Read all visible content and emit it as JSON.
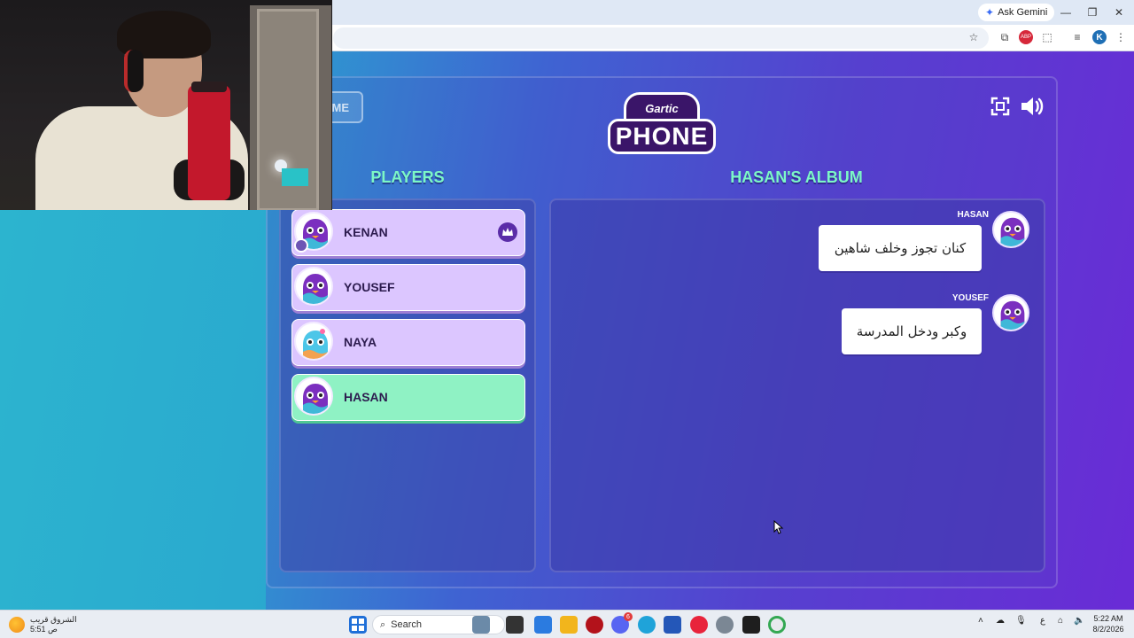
{
  "browser": {
    "gemini_label": "Ask Gemini",
    "ext_badge": "ABP",
    "profile_initial": "K"
  },
  "game": {
    "home_label": "ME",
    "logo_top": "Gartic",
    "logo_main": "PHONE",
    "players_title": "PLAYERS",
    "album_title": "HASAN'S ALBUM"
  },
  "players": [
    {
      "name": "KENAN",
      "host": true,
      "active": false
    },
    {
      "name": "YOUSEF",
      "host": false,
      "active": false
    },
    {
      "name": "NAYA",
      "host": false,
      "active": false
    },
    {
      "name": "HASAN",
      "host": false,
      "active": true
    }
  ],
  "album": {
    "messages": [
      {
        "author": "HASAN",
        "text": "كنان تجوز وخلف شاهين"
      },
      {
        "author": "YOUSEF",
        "text": "وكبر ودخل المدرسة"
      }
    ]
  },
  "taskbar": {
    "weather_title": "الشروق قريب",
    "weather_time": "5:51 ص",
    "search_label": "Search",
    "lang": "ع",
    "time": "5:22 AM",
    "date": "8/2/2026",
    "notification_count": "6"
  },
  "colors": {
    "accent_green": "#7cf7c6",
    "player_card": "#dcc6ff",
    "active_card": "#8ff2c4",
    "logo_bg": "#3a1569"
  }
}
